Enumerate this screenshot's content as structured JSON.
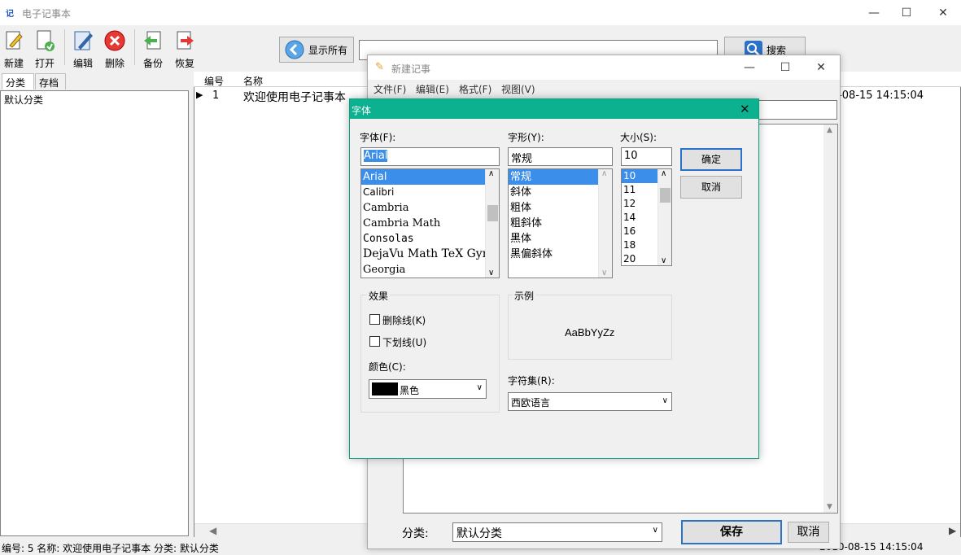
{
  "main": {
    "title": "电子记事本",
    "app_icon": "记",
    "toolbar": {
      "new": "新建",
      "open": "打开",
      "edit": "编辑",
      "delete": "删除",
      "backup": "备份",
      "restore": "恢复",
      "show_all": "显示所有",
      "search": "搜索",
      "search_value": ""
    },
    "tabs": [
      "分类",
      "存档"
    ],
    "categories": [
      "默认分类"
    ],
    "grid": {
      "columns": [
        "编号",
        "名称"
      ],
      "rows": [
        {
          "id": "1",
          "name": "欢迎使用电子记事本",
          "time": "2010-08-15 14:15:04"
        }
      ]
    },
    "status": {
      "text": "编号: 5  名称: 欢迎使用电子记事本  分类: 默认分类",
      "time": "2010-08-15 14:15:04"
    }
  },
  "note": {
    "title": "新建记事",
    "menus": [
      "文件(F)",
      "编辑(E)",
      "格式(F)",
      "视图(V)"
    ],
    "category_label": "分类:",
    "category_value": "默认分类",
    "save": "保存",
    "cancel": "取消"
  },
  "font_dialog": {
    "title": "字体",
    "font_label": "字体(F):",
    "font_value": "Arial",
    "fonts": [
      "Arial",
      "Calibri",
      "Cambria",
      "Cambria Math",
      "Consolas",
      "DejaVu Math TeX Gyre",
      "Georgia"
    ],
    "style_label": "字形(Y):",
    "style_value": "常规",
    "styles": [
      "常规",
      "斜体",
      "粗体",
      "粗斜体",
      "黑体",
      "黑偏斜体"
    ],
    "size_label": "大小(S):",
    "size_value": "10",
    "sizes": [
      "10",
      "11",
      "12",
      "14",
      "16",
      "18",
      "20"
    ],
    "ok": "确定",
    "cancel": "取消",
    "effects_label": "效果",
    "strike_label": "删除线(K)",
    "underline_label": "下划线(U)",
    "color_label": "颜色(C):",
    "color_value": "黑色",
    "sample_label": "示例",
    "sample_text": "AaBbYyZz",
    "charset_label": "字符集(R):",
    "charset_value": "西欧语言"
  },
  "colors": {
    "dialog_title": "#0cb190",
    "selection": "#3b8eea"
  }
}
